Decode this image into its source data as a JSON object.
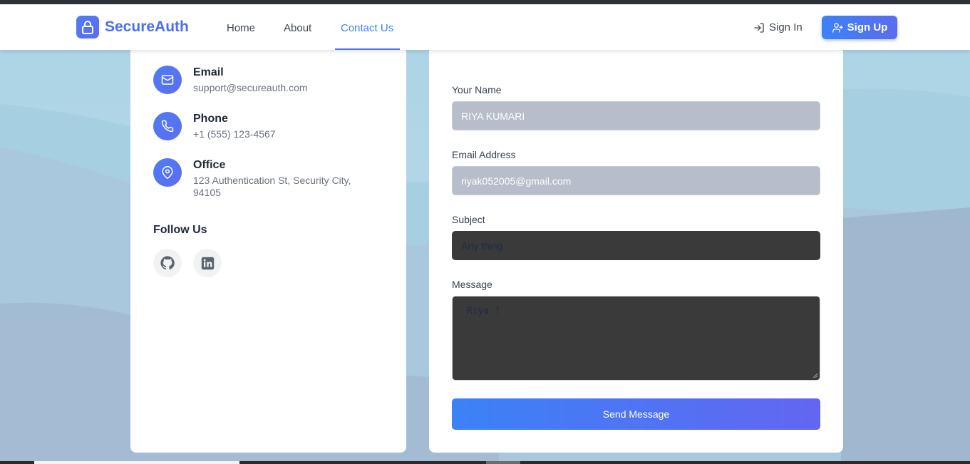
{
  "brand": {
    "name": "SecureAuth",
    "logo_icon": "lock-icon",
    "accent": "#4a6ff0"
  },
  "nav": {
    "links": [
      {
        "label": "Home",
        "active": false
      },
      {
        "label": "About",
        "active": false
      },
      {
        "label": "Contact Us",
        "active": true
      }
    ],
    "signin_label": "Sign In",
    "signup_label": "Sign Up"
  },
  "contact_info": {
    "items": [
      {
        "title": "Email",
        "value": "support@secureauth.com",
        "icon": "mail-icon"
      },
      {
        "title": "Phone",
        "value": "+1 (555) 123-4567",
        "icon": "phone-icon"
      },
      {
        "title": "Office",
        "value": "123 Authentication St, Security City, 94105",
        "icon": "map-pin-icon"
      }
    ],
    "follow_title": "Follow Us",
    "socials": [
      {
        "icon": "github-icon"
      },
      {
        "icon": "linkedin-icon"
      }
    ]
  },
  "form": {
    "name_label": "Your Name",
    "name_value": "RIYA KUMARI",
    "email_label": "Email Address",
    "email_value": "riyak052005@gmail.com",
    "subject_label": "Subject",
    "subject_value": "Any thing",
    "message_label": "Message",
    "message_value": "Riya !",
    "submit_label": "Send Message"
  },
  "colors": {
    "primary_gradient_start": "#3b82f6",
    "primary_gradient_end": "#6366f1",
    "nav_active": "#3b82f6"
  }
}
